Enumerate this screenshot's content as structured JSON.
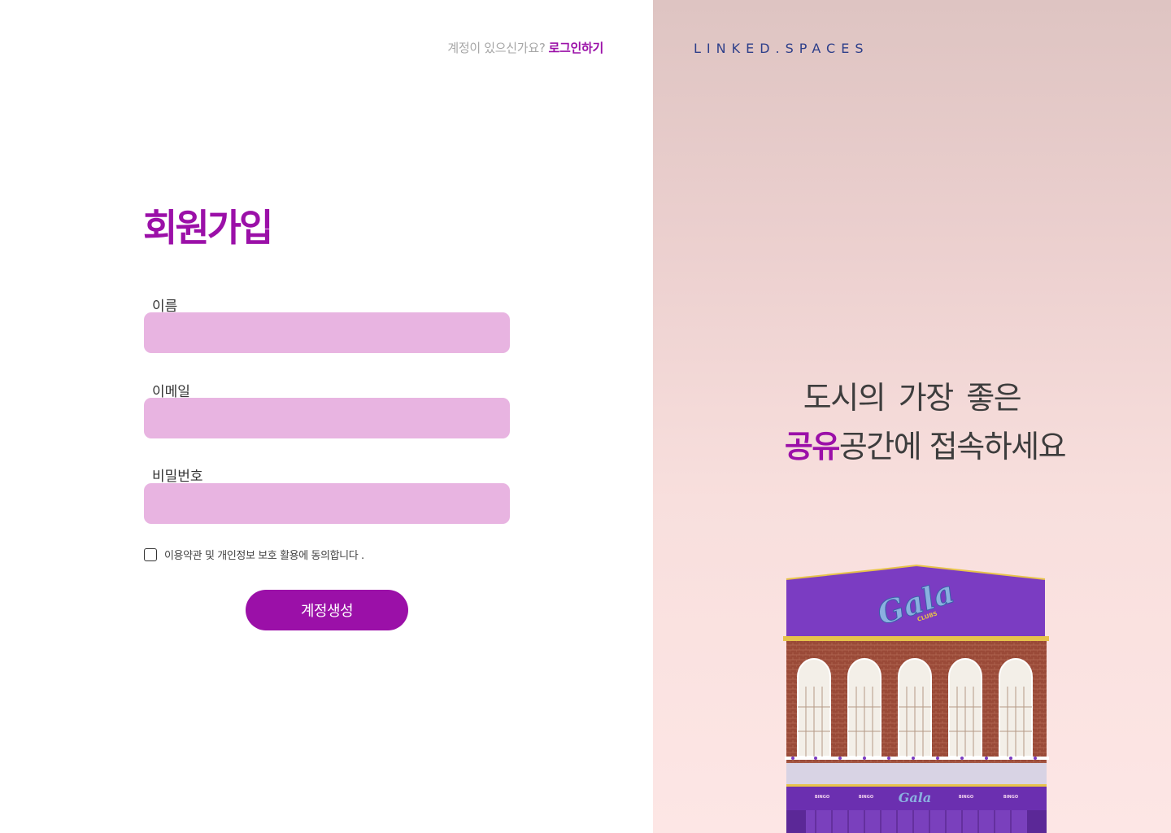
{
  "colors": {
    "brand_purple": "#9b10a8",
    "input_bg": "#e8b4e1",
    "brand_navy": "#2d3f8a"
  },
  "top_prompt": {
    "question": "계정이 있으신가요?",
    "login_link": "로그인하기"
  },
  "form": {
    "title": "회원가입",
    "fields": [
      {
        "label": "이름",
        "value": ""
      },
      {
        "label": "이메일",
        "value": ""
      },
      {
        "label": "비밀번호",
        "value": ""
      }
    ],
    "agreement": {
      "label": "이용약관 및 개인정보 보호 활용에 동의합니다 .",
      "checked": false
    },
    "submit_label": "계정생성"
  },
  "hero": {
    "brand": "LINKED.SPACES",
    "headline_line1": "도시의 가장 좋은",
    "headline_accent": "공유",
    "headline_rest": "공간에 접속하세요",
    "building_sign": "Gala",
    "building_sign_sub": "CLUBS",
    "building_banner_items": [
      "BINGO",
      "BINGO",
      "BINGO",
      "BINGO"
    ]
  }
}
